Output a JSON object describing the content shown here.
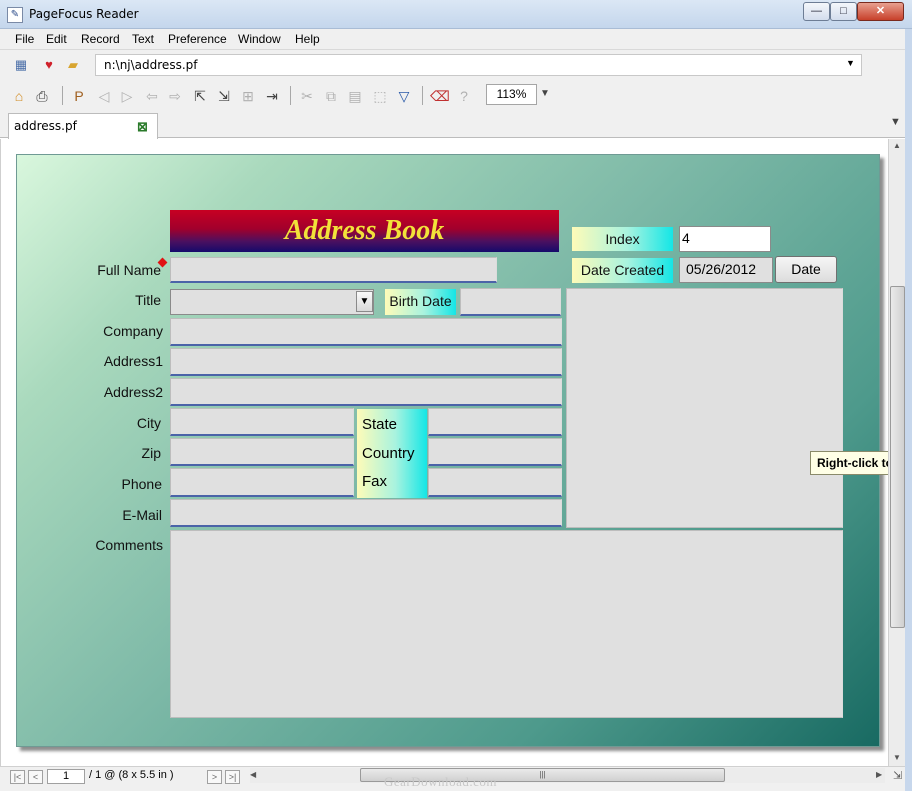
{
  "window": {
    "title": "PageFocus Reader",
    "min_glyph": "—",
    "max_glyph": "□",
    "close_glyph": "✕"
  },
  "menu": [
    "File",
    "Edit",
    "Record",
    "Text",
    "Preference",
    "Window",
    "Help"
  ],
  "address_bar": {
    "path": "n:\\nj\\address.pf"
  },
  "toolbar": {
    "zoom": "113%"
  },
  "tab": {
    "label": "address.pf"
  },
  "form": {
    "title": "Address Book",
    "labels": {
      "full_name": "Full Name",
      "title": "Title",
      "company": "Company",
      "address1": "Address1",
      "address2": "Address2",
      "city": "City",
      "zip": "Zip",
      "phone": "Phone",
      "email": "E-Mail",
      "comments": "Comments",
      "birth_date": "Birth Date",
      "state": "State",
      "country": "Country",
      "fax": "Fax",
      "index": "Index",
      "date_created": "Date Created"
    },
    "values": {
      "index": "4",
      "date_created": "05/26/2012"
    },
    "date_button": "Date"
  },
  "tooltip": "Right-click to e",
  "pager": {
    "page": "1",
    "info": "/ 1 @ (8 x 5.5 in )"
  },
  "watermark": "GearDownload.com"
}
